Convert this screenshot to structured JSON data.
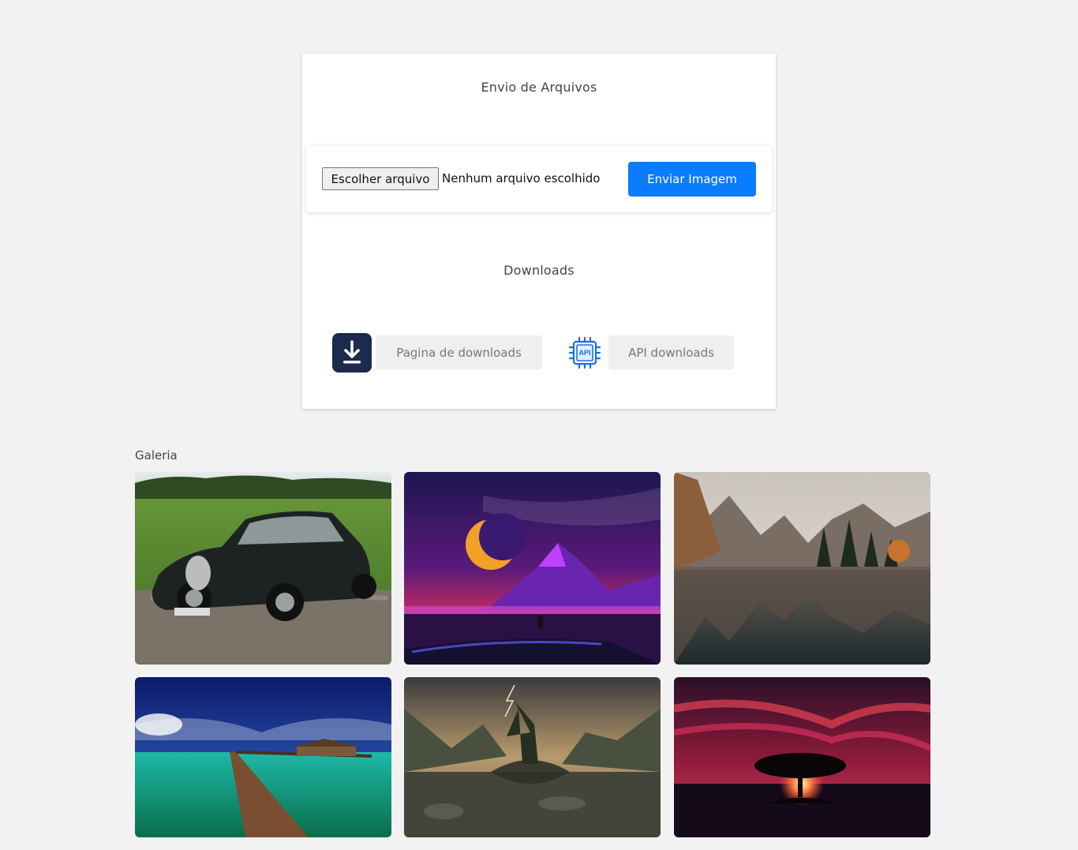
{
  "upload": {
    "title": "Envio de Arquivos",
    "choose_file_label": "Escolher arquivo",
    "file_status": "Nenhum arquivo escolhido",
    "send_label": "Enviar Imagem"
  },
  "downloads": {
    "title": "Downloads",
    "page_link": "Pagina de downloads",
    "api_link": "API downloads",
    "page_icon": "download-icon",
    "api_icon": "api-chip-icon",
    "api_icon_text": "API"
  },
  "gallery": {
    "title": "Galeria"
  },
  "colors": {
    "accent": "#0a7cff",
    "download_icon_bg": "#1c2a4d",
    "page_bg": "#f2f2f2"
  }
}
